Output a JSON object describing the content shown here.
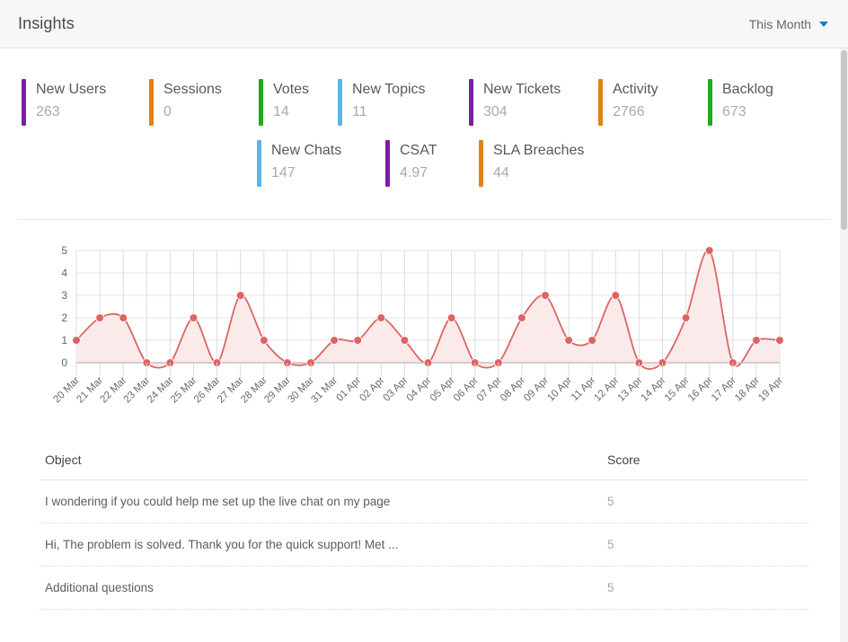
{
  "header": {
    "title": "Insights",
    "range_label": "This Month",
    "caret_icon": "chevron-down-icon",
    "caret_color": "#1a7bbd"
  },
  "kpis": {
    "row1": [
      {
        "label": "New Users",
        "value": "263",
        "color": "#7b1fa2"
      },
      {
        "label": "Sessions",
        "value": "0",
        "color": "#e08214"
      },
      {
        "label": "Votes",
        "value": "14",
        "color": "#1faa1f"
      },
      {
        "label": "New Topics",
        "value": "11",
        "color": "#5bb4e5"
      },
      {
        "label": "New Tickets",
        "value": "304",
        "color": "#7b1fa2"
      },
      {
        "label": "Activity",
        "value": "2766",
        "color": "#e08214"
      },
      {
        "label": "Backlog",
        "value": "673",
        "color": "#1faa1f"
      }
    ],
    "row2": [
      {
        "label": "New Chats",
        "value": "147",
        "color": "#5bb4e5"
      },
      {
        "label": "CSAT",
        "value": "4.97",
        "color": "#7b1fa2"
      },
      {
        "label": "SLA Breaches",
        "value": "44",
        "color": "#e08214"
      }
    ]
  },
  "chart_data": {
    "type": "area",
    "title": "",
    "xlabel": "",
    "ylabel": "",
    "ylim": [
      0,
      5
    ],
    "yticks": [
      0,
      1,
      2,
      3,
      4,
      5
    ],
    "grid": true,
    "legend": false,
    "line_color": "#dd6464",
    "fill_color": "#fbeaea",
    "marker_color": "#dd6464",
    "categories": [
      "20 Mar",
      "21 Mar",
      "22 Mar",
      "23 Mar",
      "24 Mar",
      "25 Mar",
      "26 Mar",
      "27 Mar",
      "28 Mar",
      "29 Mar",
      "30 Mar",
      "31 Mar",
      "01 Apr",
      "02 Apr",
      "03 Apr",
      "04 Apr",
      "05 Apr",
      "06 Apr",
      "07 Apr",
      "08 Apr",
      "09 Apr",
      "10 Apr",
      "11 Apr",
      "12 Apr",
      "13 Apr",
      "14 Apr",
      "15 Apr",
      "16 Apr",
      "17 Apr",
      "18 Apr",
      "19 Apr"
    ],
    "values": [
      1,
      2,
      2,
      0,
      0,
      2,
      0,
      3,
      1,
      0,
      0,
      1,
      1,
      2,
      1,
      0,
      2,
      0,
      0,
      2,
      3,
      1,
      1,
      3,
      0,
      0,
      2,
      5,
      0,
      1,
      1
    ]
  },
  "table": {
    "columns": [
      "Object",
      "Score"
    ],
    "rows": [
      {
        "object": "I wondering if you could help me set up the live chat on my page",
        "score": "5"
      },
      {
        "object": "Hi, The problem is solved. Thank you for the quick support! Met ...",
        "score": "5"
      },
      {
        "object": "Additional questions",
        "score": "5"
      }
    ]
  }
}
